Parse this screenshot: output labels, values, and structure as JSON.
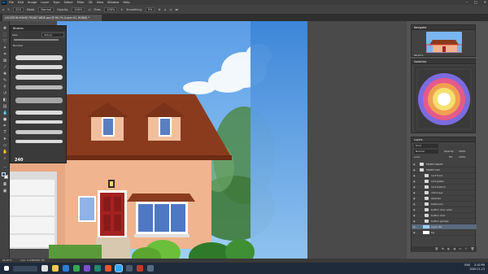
{
  "menu": {
    "app_icon": "Ps",
    "items": [
      "File",
      "Edit",
      "Image",
      "Layer",
      "Type",
      "Select",
      "Filter",
      "3D",
      "View",
      "Window",
      "Help"
    ],
    "window_controls": [
      "–",
      "□",
      "✕"
    ]
  },
  "options": {
    "size_value": "220",
    "mode_label": "Mode:",
    "mode_value": "Normal",
    "opacity_label": "Opacity:",
    "opacity_value": "100%",
    "flow_label": "Flow:",
    "flow_value": "100%",
    "smoothing_label": "Smoothing:",
    "smoothing_value": "0%"
  },
  "document": {
    "tab_title": "LOCATION HOUSE FRONT WIDE.psd @ 66.7% (Layer 61, RGB/8) *"
  },
  "brushes_panel": {
    "title": "Brushes",
    "size_label": "Size:",
    "size_value": "220 px",
    "group_label": "Brushes",
    "count_label": "240"
  },
  "navigator": {
    "title": "Navigator",
    "zoom": "66.67%"
  },
  "swatches": {
    "title": "Swatches"
  },
  "layers": {
    "title": "Layers",
    "kind_label": "Kind",
    "blend_mode": "Normal",
    "opacity_label": "Opacity:",
    "opacity_value": "100%",
    "lock_label": "Lock:",
    "fill_label": "Fill:",
    "fill_value": "100%",
    "items": [
      "FRONT NIGHT",
      "FRONT DAY",
      "roof front",
      "roof gutter",
      "roof bottom",
      "chimneys",
      "skylines",
      "bathroom",
      "button door open",
      "button door",
      "button garage",
      "Layer 69",
      "bg"
    ]
  },
  "status": {
    "zoom": "66.67%",
    "doc": "Doc: 5.93M/495.7M"
  },
  "taskbar": {
    "lang": "ENG",
    "time": "2:10 PM",
    "date": "2020-11-13"
  },
  "colors": {
    "ui_dark": "#424242",
    "ui_mid": "#535353",
    "sky_blue": "#6aaef0",
    "roof_brown": "#8a3b1e",
    "wall_peach": "#f0b48e",
    "door_red": "#a42222"
  }
}
